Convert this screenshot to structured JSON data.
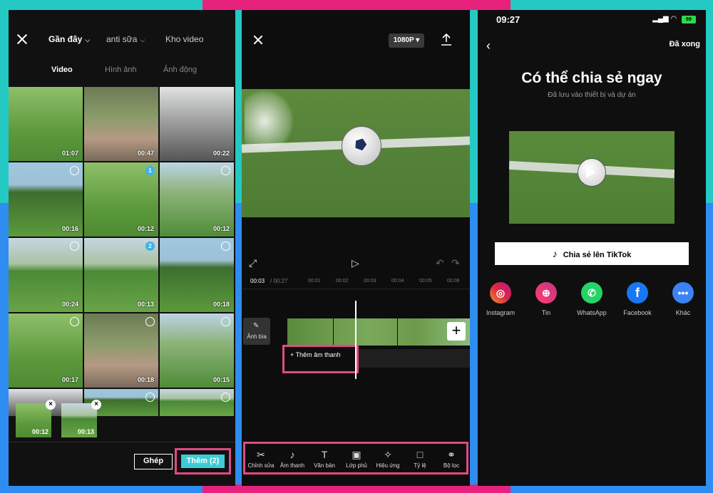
{
  "panel1": {
    "tabs": [
      {
        "label": "Gần đây",
        "dropdown": true,
        "active": true
      },
      {
        "label": "anti sữa",
        "dropdown": true,
        "active": false
      },
      {
        "label": "Kho video",
        "dropdown": false,
        "active": false
      }
    ],
    "subtabs": [
      {
        "label": "Video",
        "active": true
      },
      {
        "label": "Hình ảnh",
        "active": false
      },
      {
        "label": "Ảnh động",
        "active": false
      }
    ],
    "grid": [
      {
        "duration": "01:07",
        "badge": ""
      },
      {
        "duration": "00:47",
        "badge": ""
      },
      {
        "duration": "00:22",
        "badge": ""
      },
      {
        "duration": "00:16",
        "badge": "circle"
      },
      {
        "duration": "00:12",
        "badge": "1"
      },
      {
        "duration": "00:12",
        "badge": "circle"
      },
      {
        "duration": "00:24",
        "badge": "circle"
      },
      {
        "duration": "00:13",
        "badge": "2"
      },
      {
        "duration": "00:18",
        "badge": "circle"
      },
      {
        "duration": "00:17",
        "badge": "circle"
      },
      {
        "duration": "00:18",
        "badge": "circle"
      },
      {
        "duration": "00:15",
        "badge": "circle"
      },
      {
        "duration": "",
        "badge": ""
      },
      {
        "duration": "",
        "badge": "circle"
      },
      {
        "duration": "",
        "badge": "circle"
      }
    ],
    "tray": [
      {
        "duration": "00:12"
      },
      {
        "duration": "00:13"
      }
    ],
    "merge_label": "Ghép",
    "add_label": "Thêm (2)"
  },
  "panel2": {
    "resolution": "1080P",
    "current_time": "00:03",
    "total_time": "/ 00:27",
    "ticks": [
      "00:01",
      "00:02",
      "00:03",
      "00:04",
      "00:05",
      "00:06"
    ],
    "cover_label": "Ảnh bìa",
    "add_audio_label": "+ Thêm âm thanh",
    "tools": [
      {
        "label": "Chỉnh sửa",
        "icon": "scissors-icon"
      },
      {
        "label": "Âm thanh",
        "icon": "music-note-icon"
      },
      {
        "label": "Văn bản",
        "icon": "text-icon"
      },
      {
        "label": "Lớp phủ",
        "icon": "overlay-icon"
      },
      {
        "label": "Hiệu ứng",
        "icon": "effects-icon"
      },
      {
        "label": "Tỷ lệ",
        "icon": "ratio-icon"
      },
      {
        "label": "Bộ lọc",
        "icon": "filter-icon"
      }
    ]
  },
  "panel3": {
    "status_time": "09:27",
    "battery": "69",
    "done_label": "Đã xong",
    "title": "Có thể chia sẻ ngay",
    "subtitle": "Đã lưu vào thiết bị và dự án",
    "tiktok_label": "Chia sẻ lên TikTok",
    "apps": [
      {
        "label": "Instagram",
        "color": "#d6249f"
      },
      {
        "label": "Tin",
        "color": "#e4405f"
      },
      {
        "label": "WhatsApp",
        "color": "#25d366"
      },
      {
        "label": "Facebook",
        "color": "#1877f2"
      },
      {
        "label": "Khác",
        "color": "#3b82f6"
      }
    ]
  }
}
